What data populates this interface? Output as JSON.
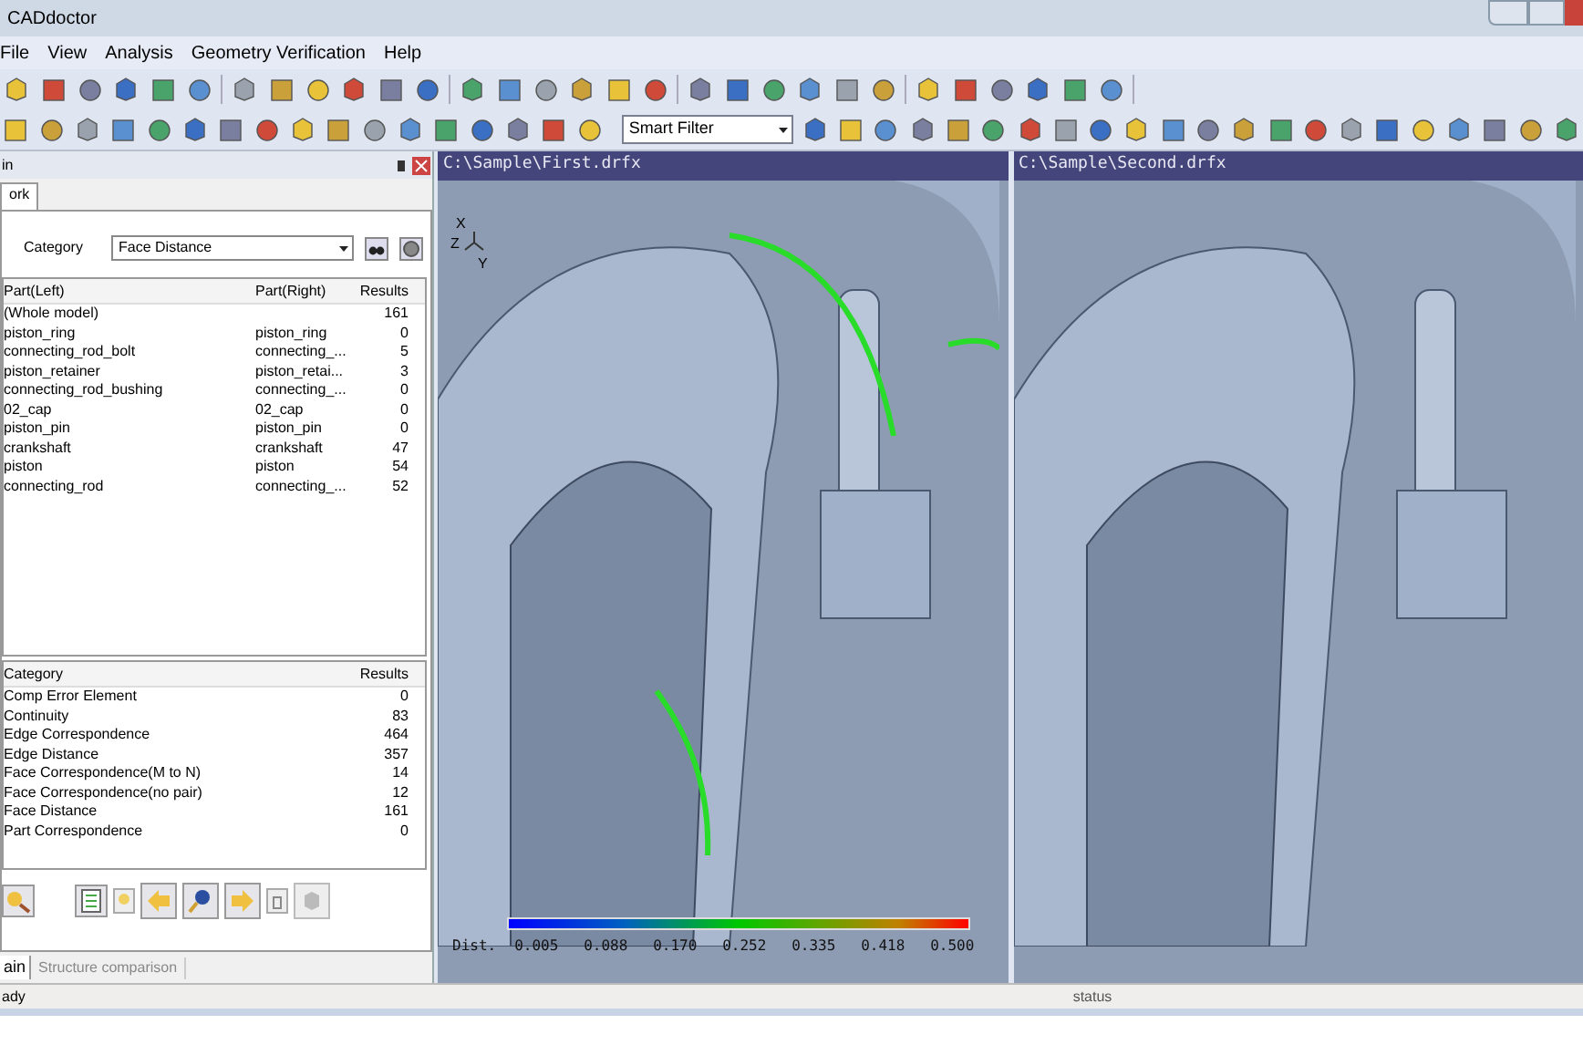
{
  "window": {
    "title": "CADdoctor"
  },
  "menu": [
    "File",
    "View",
    "Analysis",
    "Geometry Verification",
    "Help"
  ],
  "toolbar": {
    "filter": "Smart Filter"
  },
  "panel": {
    "title": "in",
    "tabs": [
      {
        "label": "ork",
        "selected": true
      }
    ],
    "category_label": "Category",
    "category": "Face Distance",
    "parts": {
      "columns": [
        "Part(Left)",
        "Part(Right)",
        "Results"
      ],
      "rows": [
        [
          "(Whole model)",
          "",
          "161"
        ],
        [
          "piston_ring",
          "piston_ring",
          "0"
        ],
        [
          "connecting_rod_bolt",
          "connecting_...",
          "5"
        ],
        [
          "piston_retainer",
          "piston_retai...",
          "3"
        ],
        [
          "connecting_rod_bushing",
          "connecting_...",
          "0"
        ],
        [
          "02_cap",
          "02_cap",
          "0"
        ],
        [
          "piston_pin",
          "piston_pin",
          "0"
        ],
        [
          "crankshaft",
          "crankshaft",
          "47"
        ],
        [
          "piston",
          "piston",
          "54"
        ],
        [
          "connecting_rod",
          "connecting_...",
          "52"
        ]
      ]
    },
    "results": {
      "columns": [
        "Category",
        "Results"
      ],
      "rows": [
        [
          "Comp Error Element",
          "0"
        ],
        [
          "Continuity",
          "83"
        ],
        [
          "Edge Correspondence",
          "464"
        ],
        [
          "Edge Distance",
          "357"
        ],
        [
          "Face Correspondence(M to N)",
          "14"
        ],
        [
          "Face Correspondence(no pair)",
          "12"
        ],
        [
          "Face Distance",
          "161"
        ],
        [
          "Part Correspondence",
          "0"
        ]
      ]
    },
    "bottom_tabs": [
      {
        "label": "ain",
        "selected": true
      },
      {
        "label": "Structure comparison",
        "selected": false
      }
    ]
  },
  "viewports": [
    {
      "title": "C:\\Sample\\First.drfx",
      "axes": [
        "X",
        "Z",
        "Y"
      ],
      "legend": {
        "label": "Dist.",
        "ticks": [
          "0.005",
          "0.088",
          "0.170",
          "0.252",
          "0.335",
          "0.418",
          "0.500"
        ]
      }
    },
    {
      "title": "C:\\Sample\\Second.drfx"
    }
  ],
  "status_bar": {
    "left": "ady",
    "right": "status"
  }
}
